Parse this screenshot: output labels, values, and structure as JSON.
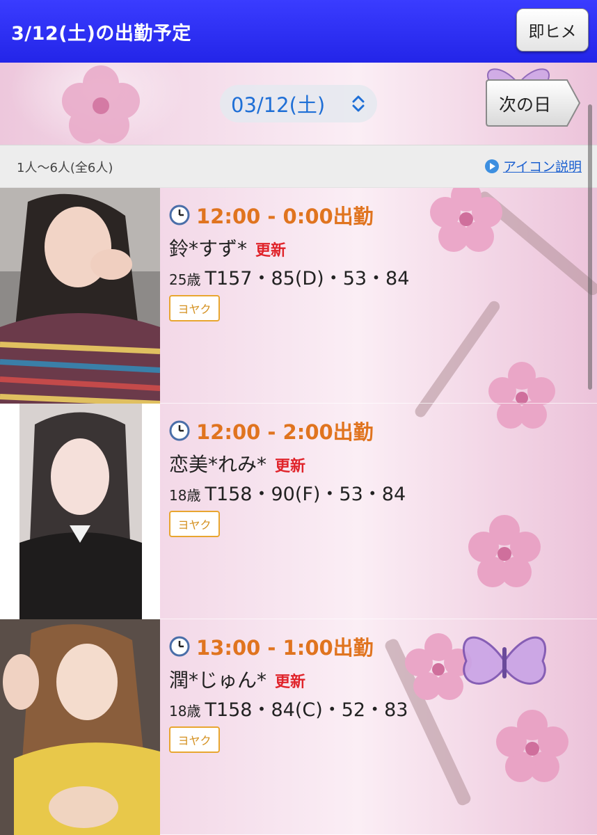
{
  "header": {
    "title": "3/12(土)の出勤予定",
    "instant_button": "即ヒメ"
  },
  "date_nav": {
    "selected_date": "03/12(土)",
    "next_day_label": "次の日"
  },
  "summary": {
    "count_text": "1人〜6人(全6人)",
    "icon_help_link": "アイコン説明"
  },
  "casts": [
    {
      "shift": "12:00 - 0:00出勤",
      "name": "鈴*すず*",
      "badge": "更新",
      "age": "25歳",
      "measurements": "T157・85(D)・53・84",
      "reserve_label": "ヨヤク"
    },
    {
      "shift": "12:00 - 2:00出勤",
      "name": "恋美*れみ*",
      "badge": "更新",
      "age": "18歳",
      "measurements": "T158・90(F)・53・84",
      "reserve_label": "ヨヤク"
    },
    {
      "shift": "13:00 - 1:00出勤",
      "name": "潤*じゅん*",
      "badge": "更新",
      "age": "18歳",
      "measurements": "T158・84(C)・52・83",
      "reserve_label": "ヨヤク"
    }
  ],
  "colors": {
    "header_bg": "#2325e8",
    "shift_time": "#e0741f",
    "update_badge": "#e0232a",
    "reserve_border": "#e8a630",
    "link": "#1a5fd0"
  },
  "icons": [
    "clock-icon",
    "play-icon",
    "chevron-updown-icon"
  ]
}
